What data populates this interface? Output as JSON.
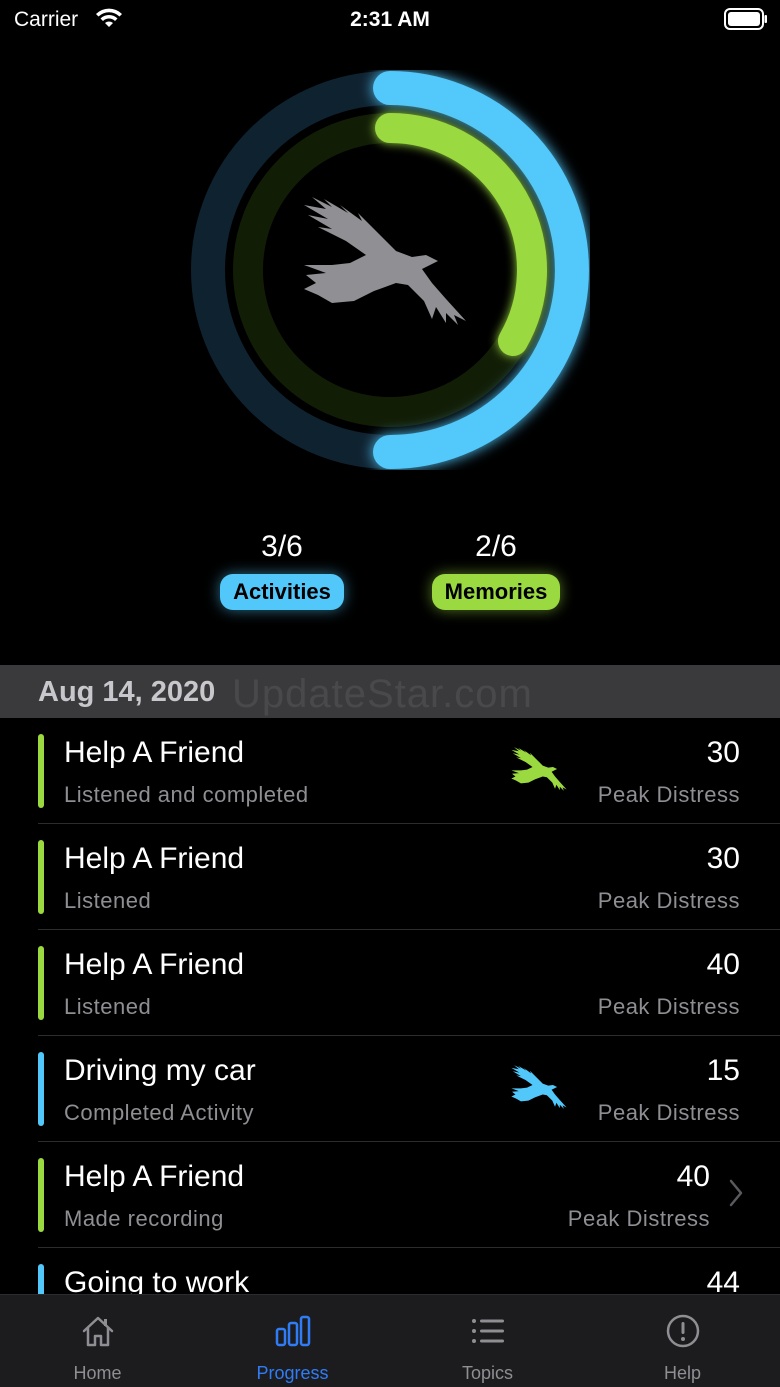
{
  "status_bar": {
    "carrier": "Carrier",
    "time": "2:31 AM"
  },
  "rings": {
    "activities_progress": 0.5,
    "memories_progress": 0.3333,
    "activities_color": "#52c8fa",
    "memories_color": "#9ad93f",
    "center_icon": "eagle-icon"
  },
  "stats": {
    "activities": {
      "count": "3/6",
      "label": "Activities"
    },
    "memories": {
      "count": "2/6",
      "label": "Memories"
    }
  },
  "date_header": "Aug 14, 2020",
  "watermark": "UpdateStar.com",
  "entries": [
    {
      "title": "Help A Friend",
      "subtitle": "Listened and completed",
      "value": "30",
      "value_label": "Peak Distress",
      "bar_color": "#9ad93f",
      "bird_color": "#9ad93f",
      "chevron": false
    },
    {
      "title": "Help A Friend",
      "subtitle": "Listened",
      "value": "30",
      "value_label": "Peak Distress",
      "bar_color": "#9ad93f",
      "chevron": false
    },
    {
      "title": "Help A Friend",
      "subtitle": "Listened",
      "value": "40",
      "value_label": "Peak Distress",
      "bar_color": "#9ad93f",
      "chevron": false
    },
    {
      "title": "Driving my car",
      "subtitle": "Completed Activity",
      "value": "15",
      "value_label": "Peak Distress",
      "bar_color": "#52c8fa",
      "bird_color": "#52c8fa",
      "chevron": false
    },
    {
      "title": "Help A Friend",
      "subtitle": "Made recording",
      "value": "40",
      "value_label": "Peak Distress",
      "bar_color": "#9ad93f",
      "chevron": true
    },
    {
      "title": "Going to work",
      "subtitle": "",
      "value": "44",
      "value_label": "",
      "bar_color": "#52c8fa",
      "chevron": false
    }
  ],
  "tabs": [
    {
      "label": "Home",
      "icon": "home-icon",
      "active": false
    },
    {
      "label": "Progress",
      "icon": "bar-chart-icon",
      "active": true
    },
    {
      "label": "Topics",
      "icon": "list-icon",
      "active": false
    },
    {
      "label": "Help",
      "icon": "exclamation-circle-icon",
      "active": false
    }
  ]
}
